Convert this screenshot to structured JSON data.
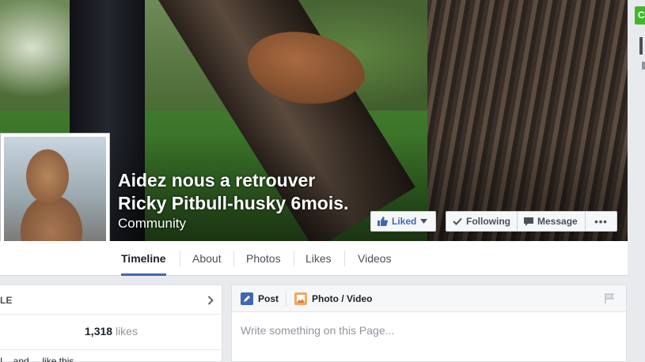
{
  "page": {
    "name_line1": "Aidez nous a retrouver",
    "name_line2": "Ricky Pitbull-husky 6mois.",
    "category": "Community"
  },
  "cover_buttons": {
    "liked": "Liked",
    "following": "Following",
    "message": "Message",
    "more": "•••"
  },
  "tabs": [
    {
      "label": "Timeline",
      "active": true
    },
    {
      "label": "About",
      "active": false
    },
    {
      "label": "Photos",
      "active": false
    },
    {
      "label": "Likes",
      "active": false
    },
    {
      "label": "Videos",
      "active": false
    }
  ],
  "left_card": {
    "header": "LE",
    "likes_count": "1,318",
    "likes_label": "likes",
    "footer_partial": "I... and ... like this"
  },
  "composer": {
    "post_label": "Post",
    "photo_video_label": "Photo / Video",
    "placeholder": "Write something on this Page..."
  },
  "right_edge": {
    "green_button_initial": "C"
  },
  "colors": {
    "accent": "#4267b2",
    "green": "#42b72a",
    "background": "#e9eaed"
  },
  "icons": {
    "liked": "thumbs-up-icon",
    "following": "checkmark-icon",
    "message": "chat-bubble-icon",
    "post": "pencil-icon",
    "photo": "camera-icon",
    "flag": "flag-icon",
    "chevron": "chevron-right-icon"
  }
}
